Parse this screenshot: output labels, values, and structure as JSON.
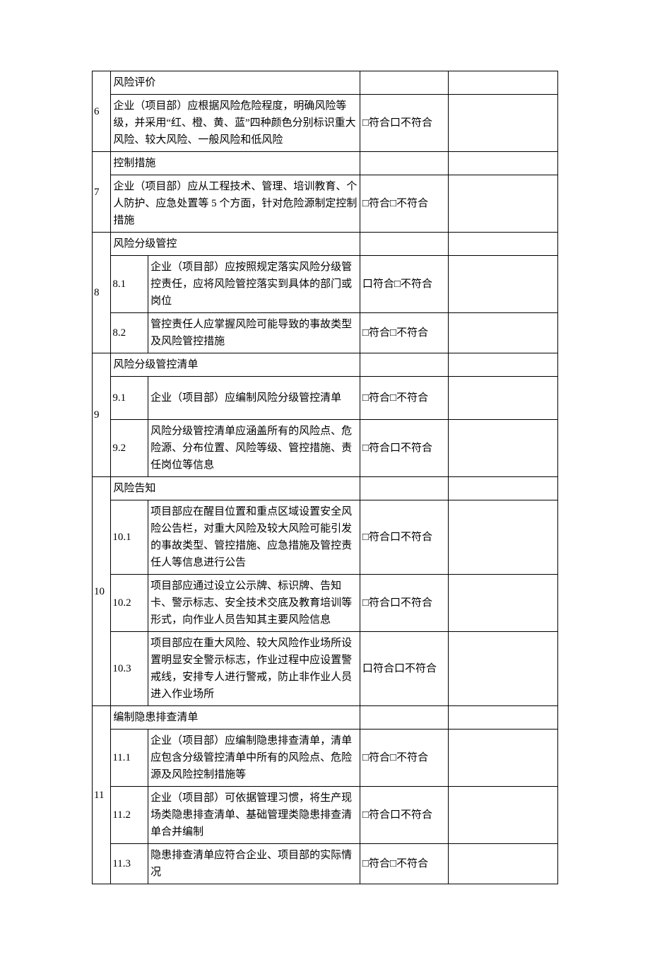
{
  "checkbox_symbol": "□",
  "mouth_symbol": "口",
  "conform": "符合",
  "not_conform": "不符合",
  "rows": {
    "r5b": {
      "title": "风险评价"
    },
    "r6": {
      "num": "6",
      "content": "企业（项目部）应根据风险危险程度，明确风险等级，并采用“红、橙、黄、蓝”四种颜色分别标识重大风险、较大风险、一般风险和低风险",
      "result_parts": [
        "□",
        "符合",
        "口",
        "不符合"
      ]
    },
    "r7": {
      "num": "7",
      "title": "控制措施",
      "content": "企业（项目部）应从工程技术、管理、培训教育、个人防护、应急处置等 5 个方面，针对危险源制定控制措施",
      "result_parts": [
        "□",
        "符合",
        "□",
        "不符合"
      ]
    },
    "r8": {
      "num": "8",
      "title": "风险分级管控",
      "sub1": "8.1",
      "content1": "企业（项目部）应按照规定落实风险分级管控责任，应将风险管控落实到具体的部门或岗位",
      "result1_parts": [
        "口",
        "符合",
        "□",
        "不符合"
      ],
      "sub2": "8.2",
      "content2": "管控责任人应掌握风险可能导致的事故类型及风险管控措施",
      "result2_parts": [
        "□",
        "符合",
        "□",
        "不符合"
      ]
    },
    "r9": {
      "num": "9",
      "title": "风险分级管控清单",
      "sub1": "9.1",
      "content1": "企业（项目部）应编制风险分级管控清单",
      "result1_parts": [
        "□",
        "符合",
        "□",
        "不符合"
      ],
      "sub2": "9.2",
      "content2": "风险分级管控清单应涵盖所有的风险点、危险源、分布位置、风险等级、管控措施、责任岗位等信息",
      "result2_parts": [
        "□",
        "符合",
        "口",
        "不符合"
      ]
    },
    "r10": {
      "num": "10",
      "title": "风险告知",
      "sub1": "10.1",
      "content1": "项目部应在醒目位置和重点区域设置安全风险公告栏，对重大风险及较大风险可能引发的事故类型、管控措施、应急措施及管控责任人等信息进行公告",
      "result1_parts": [
        "□",
        "符合",
        "口",
        "不符合"
      ],
      "sub2": "10.2",
      "content2": "项目部应通过设立公示牌、标识牌、告知卡、警示标志、安全技术交底及教育培训等形式，向作业人员告知其主要风险信息",
      "result2_parts": [
        "□",
        "符合",
        "口",
        "不符合"
      ],
      "sub3": "10.3",
      "content3": "项目部应在重大风险、较大风险作业场所设置明显安全警示标志，作业过程中应设置警戒线，安排专人进行警戒，防止非作业人员进入作业场所",
      "result3_parts": [
        "口",
        "符合",
        "口",
        "不符合"
      ]
    },
    "r11": {
      "num": "11",
      "title": "编制隐患排查清单",
      "sub1": "11.1",
      "content1": "企业（项目部）应编制隐患排查清单，清单应包含分级管控清单中所有的风险点、危险源及风险控制措施等",
      "result1_parts": [
        "□",
        "符合",
        "□",
        "不符合"
      ],
      "sub2": "11.2",
      "content2": "企业（项目部）可依据管理习惯，将生产现场类隐患排查清单、基础管理类隐患排查清单合并编制",
      "result2_parts": [
        "□",
        "符合",
        "口",
        "不符合"
      ],
      "sub3": "11.3",
      "content3": "隐患排查清单应符合企业、项目部的实际情况",
      "result3_parts": [
        "□",
        "符合",
        "□",
        "不符合"
      ]
    }
  }
}
